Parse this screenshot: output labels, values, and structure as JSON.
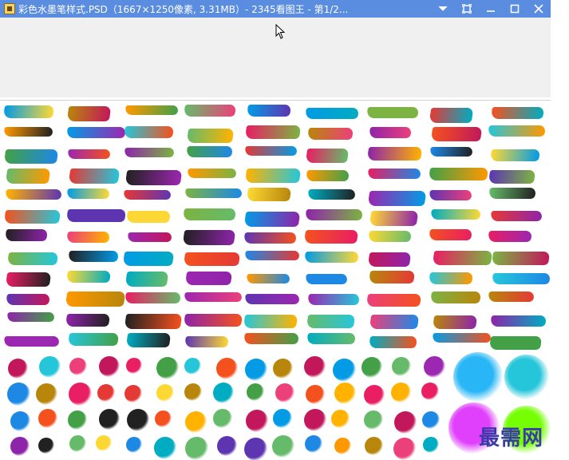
{
  "window": {
    "title": "彩色水墨笔样式.PSD（1667×1250像素, 3.31MB）- 2345看图王 - 第1/2...",
    "controls": [
      "chevron-down-icon",
      "fullscreen-icon",
      "minimize-icon",
      "maximize-icon",
      "close-icon"
    ]
  },
  "colors": {
    "titlebar": "#5a8de0",
    "toolbar_bg": "#f0f0f0",
    "canvas_bg": "#ffffff",
    "stroke_palette": [
      "#1e88e5",
      "#8e24aa",
      "#f4511e",
      "#43a047",
      "#00acc1",
      "#b8860b",
      "#e91e63",
      "#7cb342",
      "#039be5",
      "#e53935",
      "#fdd835",
      "#5e35b1",
      "#212121",
      "#ff9800",
      "#26c6da",
      "#c2185b",
      "#9c27b0",
      "#ffb300",
      "#66bb6a",
      "#ec407a"
    ]
  },
  "watermark": {
    "text": "最需网"
  }
}
